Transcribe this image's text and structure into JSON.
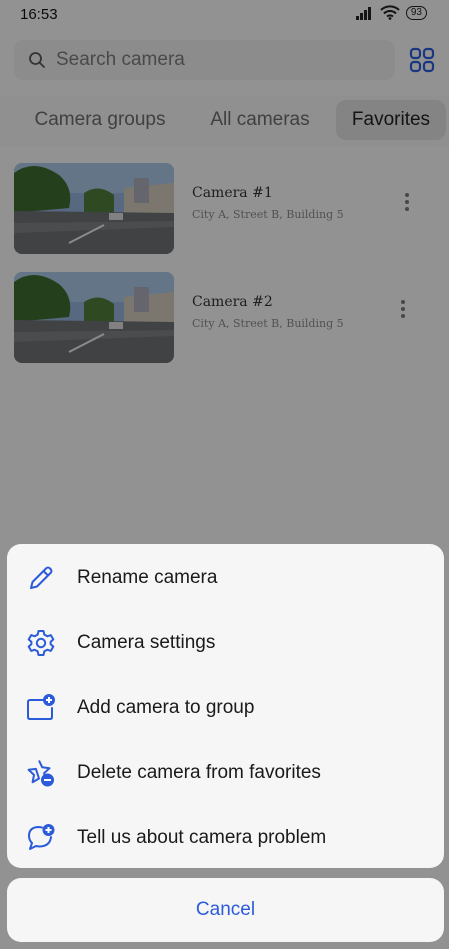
{
  "status_bar": {
    "time": "16:53",
    "battery": "93"
  },
  "search": {
    "placeholder": "Search camera"
  },
  "tabs": [
    {
      "label": "Camera groups"
    },
    {
      "label": "All cameras"
    },
    {
      "label": "Favorites"
    }
  ],
  "cameras": [
    {
      "name": "Camera #1",
      "address": "City A, Street B, Building 5"
    },
    {
      "name": "Camera #2",
      "address": "City A, Street B, Building 5"
    }
  ],
  "sheet": {
    "items": [
      {
        "label": "Rename camera",
        "icon": "pencil-icon"
      },
      {
        "label": "Camera settings",
        "icon": "gear-icon"
      },
      {
        "label": "Add camera to group",
        "icon": "folder-plus-icon"
      },
      {
        "label": "Delete camera from favorites",
        "icon": "star-minus-icon"
      },
      {
        "label": "Tell us about camera problem",
        "icon": "chat-plus-icon"
      }
    ],
    "cancel_label": "Cancel"
  },
  "colors": {
    "accent": "#2b5bd8"
  }
}
